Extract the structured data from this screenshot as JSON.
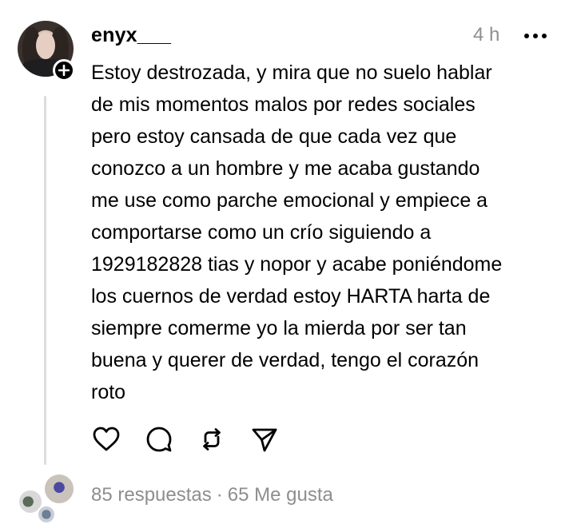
{
  "post": {
    "username": "enyx___",
    "timestamp": "4 h",
    "text": "Estoy destrozada, y mira que no suelo hablar\nde mis momentos malos por redes sociales\npero estoy cansada de que cada vez que\nconozco a un hombre y me acaba gustando\nme use como parche emocional y empiece a\ncomportarse como un crío siguiendo a\n1929182828 tias y nopor y acabe poniéndome\nlos cuernos de verdad estoy HARTA harta de\nsiempre comerme yo la mierda por ser tan\nbuena y querer de verdad, tengo el corazón\nroto",
    "icons": {
      "more": "more-horizontal-icon",
      "follow": "plus-icon",
      "like": "heart-icon",
      "reply": "comment-bubble-icon",
      "repost": "repost-icon",
      "share": "send-icon"
    }
  },
  "footer": {
    "replies": "85 respuestas",
    "separator": "·",
    "likes": "65 Me gusta"
  },
  "colors": {
    "text": "#000000",
    "muted": "#8e8e8e",
    "thread_line": "#dcdcdc"
  }
}
